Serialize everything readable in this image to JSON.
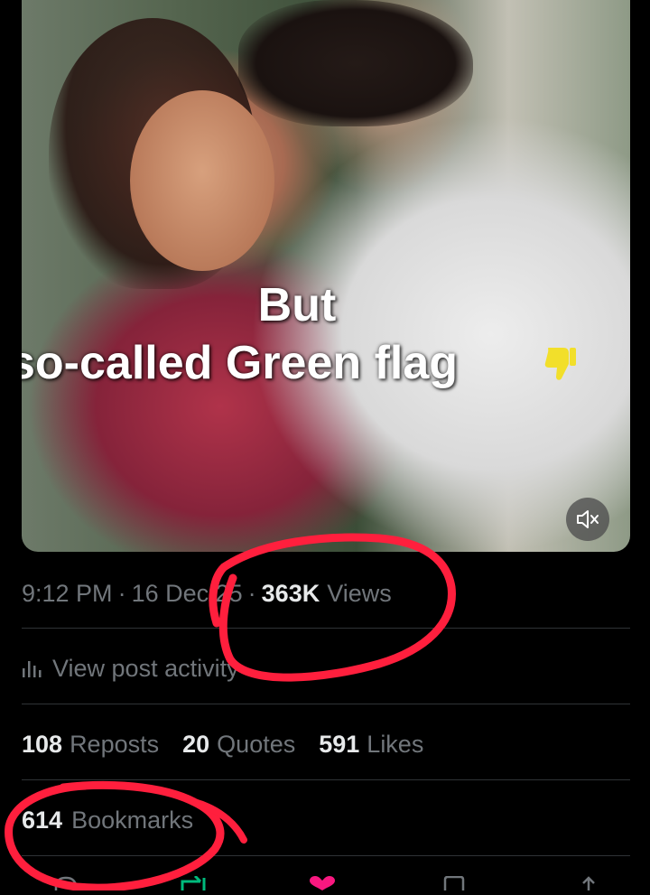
{
  "media": {
    "caption_line1": "But",
    "caption_line2": "so-called Green flag",
    "emoji_icon": "thumbs-down-icon",
    "mute_icon": "speaker-muted-icon"
  },
  "meta": {
    "time": "9:12 PM",
    "separator": "·",
    "date": "16 Dec 25",
    "views_count": "363K",
    "views_label": "Views"
  },
  "activity": {
    "icon": "bar-chart-icon",
    "label": "View post activity"
  },
  "stats": [
    {
      "count": "108",
      "label": "Reposts"
    },
    {
      "count": "20",
      "label": "Quotes"
    },
    {
      "count": "591",
      "label": "Likes"
    }
  ],
  "bookmarks": {
    "count": "614",
    "label": "Bookmarks"
  },
  "actions": [
    "reply-icon",
    "repost-icon",
    "like-icon",
    "bookmark-icon",
    "share-icon"
  ],
  "colors": {
    "background": "#000000",
    "primary_text": "#e7e9ea",
    "secondary_text": "#71767b",
    "divider": "#2f3336",
    "annotation": "#ff1f3d",
    "repost_green": "#00ba7c",
    "like_pink": "#f91880"
  }
}
